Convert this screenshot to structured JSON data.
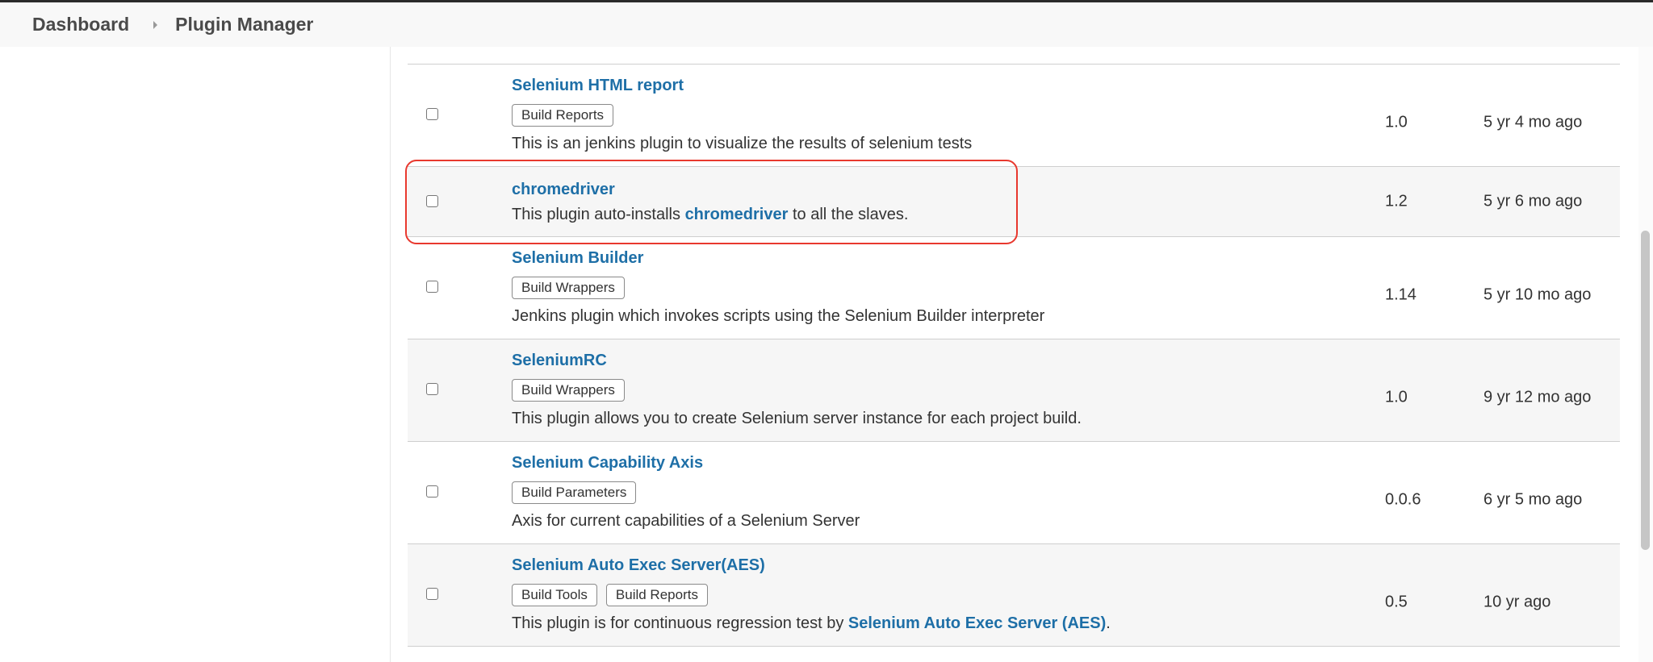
{
  "breadcrumb": {
    "items": [
      "Dashboard",
      "Plugin Manager"
    ]
  },
  "plugins": [
    {
      "name": "Selenium HTML report",
      "tags": [
        "Build Reports"
      ],
      "excerpt": {
        "before": "This is an jenkins plugin to visualize the results of selenium tests",
        "link": "",
        "after": ""
      },
      "version": "1.0",
      "released": "5 yr 4 mo ago"
    },
    {
      "name": "chromedriver",
      "tags": [],
      "excerpt": {
        "before": "This plugin auto-installs ",
        "link": "chromedriver",
        "after": " to all the slaves."
      },
      "version": "1.2",
      "released": "5 yr 6 mo ago",
      "highlighted": true
    },
    {
      "name": "Selenium Builder",
      "tags": [
        "Build Wrappers"
      ],
      "excerpt": {
        "before": "Jenkins plugin which invokes scripts using the Selenium Builder interpreter",
        "link": "",
        "after": ""
      },
      "version": "1.14",
      "released": "5 yr 10 mo ago"
    },
    {
      "name": "SeleniumRC",
      "tags": [
        "Build Wrappers"
      ],
      "excerpt": {
        "before": "This plugin allows you to create Selenium server instance for each project build.",
        "link": "",
        "after": ""
      },
      "version": "1.0",
      "released": "9 yr 12 mo ago"
    },
    {
      "name": "Selenium Capability Axis",
      "tags": [
        "Build Parameters"
      ],
      "excerpt": {
        "before": "Axis for current capabilities of a Selenium Server",
        "link": "",
        "after": ""
      },
      "version": "0.0.6",
      "released": "6 yr 5 mo ago"
    },
    {
      "name": "Selenium Auto Exec Server(AES)",
      "tags": [
        "Build Tools",
        "Build Reports"
      ],
      "excerpt": {
        "before": "This plugin is for continuous regression test by ",
        "link": "Selenium Auto Exec Server (AES)",
        "after": "."
      },
      "version": "0.5",
      "released": "10 yr ago"
    }
  ],
  "colors": {
    "link": "#1e6fa7",
    "highlight": "#e8382e",
    "row_alt": "#f6f6f6"
  }
}
